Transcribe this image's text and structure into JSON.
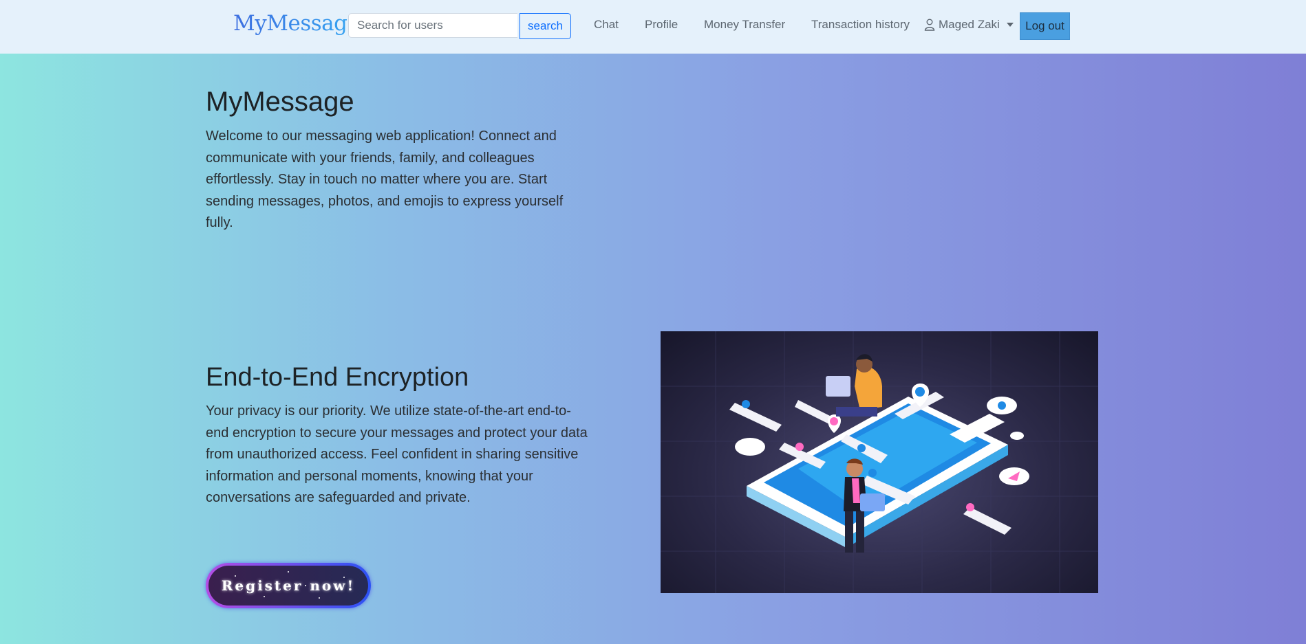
{
  "nav": {
    "brand": "MyMessage",
    "search_placeholder": "Search for users",
    "search_button": "search",
    "links": [
      "Chat",
      "Profile",
      "Money Transfer",
      "Transaction history"
    ],
    "user_name": "Maged Zaki",
    "logout": "Log out"
  },
  "hero": {
    "title": "MyMessage",
    "text": "Welcome to our messaging web application! Connect and communicate with your friends, family, and colleagues effortlessly. Stay in touch no matter where you are. Start sending messages, photos, and emojis to express yourself fully."
  },
  "encryption": {
    "title": "End-to-End Encryption",
    "text": "Your privacy is our priority. We utilize state-of-the-art end-to-end encryption to secure your messages and protect your data from unauthorized access. Feel confident in sharing sensitive information and personal moments, knowing that your conversations are safeguarded and private.",
    "register_button": "Register now!"
  },
  "colors": {
    "brand": "#3e6fe0",
    "search_border": "#0d6efd",
    "logout_bg": "#4a9fe0",
    "register_border_start": "#b44ee4",
    "register_border_end": "#2c52f5"
  }
}
